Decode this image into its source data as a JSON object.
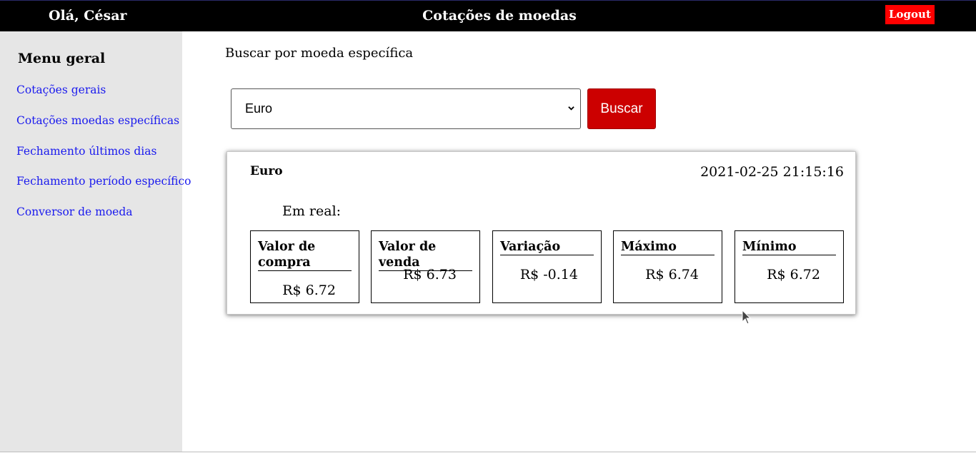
{
  "header": {
    "greeting": "Olá, César",
    "title": "Cotações de moedas",
    "logout_label": "Logout"
  },
  "sidebar": {
    "title": "Menu geral",
    "items": [
      {
        "label": "Cotações gerais"
      },
      {
        "label": "Cotações moedas específicas"
      },
      {
        "label": "Fechamento últimos dias"
      },
      {
        "label": "Fechamento período específico"
      },
      {
        "label": "Conversor de moeda"
      }
    ]
  },
  "search": {
    "label": "Buscar por moeda específica",
    "selected_currency": "Euro",
    "button_label": "Buscar"
  },
  "quote": {
    "currency": "Euro",
    "timestamp": "2021-02-25 21:15:16",
    "subtitle": "Em real:",
    "metrics": [
      {
        "label": "Valor de compra",
        "value": "R$ 6.72"
      },
      {
        "label": "Valor de venda",
        "value": "R$ 6.73"
      },
      {
        "label": "Variação",
        "value": "R$ -0.14"
      },
      {
        "label": "Máximo",
        "value": "R$ 6.74"
      },
      {
        "label": "Mínimo",
        "value": "R$ 6.72"
      }
    ]
  },
  "colors": {
    "header_bg": "#000000",
    "sidebar_bg": "#e6e6e6",
    "link": "#1a1aee",
    "logout_bg": "#ff0000",
    "search_button_bg": "#cc0000"
  },
  "icons": {
    "select_arrow": "chevron-down-icon",
    "cursor": "mouse-pointer-icon"
  }
}
